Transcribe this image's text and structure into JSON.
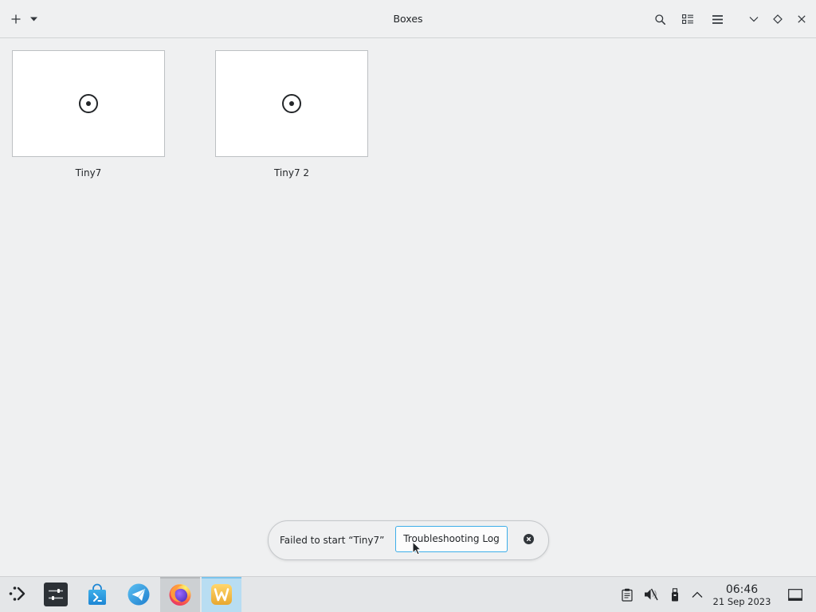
{
  "window": {
    "title": "Boxes",
    "header_icons": {
      "new": "plus-icon",
      "new_menu": "caret-down-icon",
      "search": "search-icon",
      "view": "list-view-icon",
      "menu": "hamburger-menu-icon",
      "minimize": "chevron-down-icon",
      "maximize": "diamond-icon",
      "close": "close-icon"
    }
  },
  "boxes": [
    {
      "label": "Tiny7",
      "icon": "disc-icon"
    },
    {
      "label": "Tiny7 2",
      "icon": "disc-icon"
    }
  ],
  "notification": {
    "message": "Failed to start “Tiny7”",
    "action_label": "Troubleshooting Log",
    "dismiss_icon": "close-circle-icon"
  },
  "taskbar": {
    "launcher_icon": "app-launcher-icon",
    "tasks": [
      {
        "icon": "system-settings-icon",
        "hovered": false,
        "active": false
      },
      {
        "icon": "shopping-bag-icon",
        "hovered": false,
        "active": false
      },
      {
        "icon": "paper-plane-app-icon",
        "hovered": false,
        "active": false
      },
      {
        "icon": "firefox-icon",
        "hovered": true,
        "active": false
      },
      {
        "icon": "wayland-app-icon",
        "hovered": false,
        "active": true
      }
    ],
    "tray_icons": [
      "clipboard-icon",
      "volume-muted-icon",
      "usb-device-icon",
      "chevron-up-icon"
    ],
    "clock": {
      "time": "06:46",
      "date": "21 Sep 2023"
    },
    "show_desktop_icon": "show-desktop-icon"
  },
  "colors": {
    "window_bg": "#eff0f1",
    "header_bg": "#eff0f1",
    "border": "#d1d3d5",
    "text": "#232629",
    "icon": "#31363b",
    "accent": "#3daee9",
    "thumbnail_bg": "#ffffff",
    "thumbnail_border": "#bdc0c3",
    "toast_border": "#c4c7ca",
    "taskbar_bg": "#e4e6e8",
    "task_hover_bg": "#cdd0d3",
    "task_active_bg": "#b8ddf2"
  }
}
